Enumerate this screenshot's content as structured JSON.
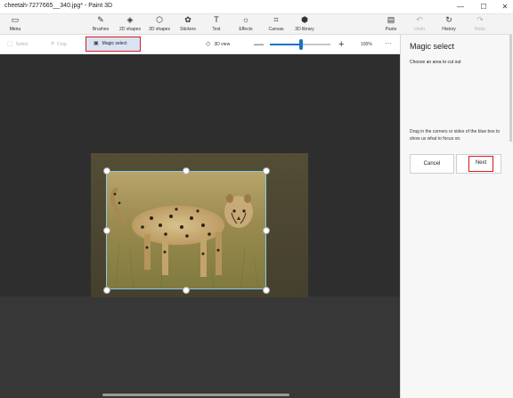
{
  "window": {
    "title": "cheetah-7277665__340.jpg* - Paint 3D",
    "minimize_glyph": "—",
    "maximize_glyph": "☐",
    "close_glyph": "✕"
  },
  "ribbon": {
    "menu": {
      "label": "Menu",
      "icon": "folder-icon",
      "glyph": "▭"
    },
    "tools": [
      {
        "label": "Brushes",
        "icon": "brush-icon",
        "glyph": "✎"
      },
      {
        "label": "2D shapes",
        "icon": "2d-shapes-icon",
        "glyph": "◈"
      },
      {
        "label": "3D shapes",
        "icon": "3d-shapes-icon",
        "glyph": "⬡"
      },
      {
        "label": "Stickers",
        "icon": "stickers-icon",
        "glyph": "✿"
      },
      {
        "label": "Text",
        "icon": "text-icon",
        "glyph": "T"
      },
      {
        "label": "Effects",
        "icon": "effects-icon",
        "glyph": "☼"
      },
      {
        "label": "Canvas",
        "icon": "canvas-icon",
        "glyph": "⌗"
      },
      {
        "label": "3D library",
        "icon": "3d-library-icon",
        "glyph": "⬢"
      }
    ],
    "paste": {
      "label": "Paste",
      "icon": "paste-icon",
      "glyph": "▤"
    },
    "undo": {
      "label": "Undo",
      "icon": "undo-icon",
      "glyph": "↶"
    },
    "history": {
      "label": "History",
      "icon": "history-icon",
      "glyph": "↻"
    },
    "redo": {
      "label": "Redo",
      "icon": "redo-icon",
      "glyph": "↷"
    }
  },
  "toolbar": {
    "select": {
      "label": "Select",
      "icon": "select-icon",
      "glyph": "⬚"
    },
    "crop": {
      "label": "Crop",
      "icon": "crop-icon",
      "glyph": "⌗"
    },
    "magic_select": {
      "label": "Magic select",
      "icon": "magic-select-icon",
      "glyph": "▣"
    },
    "view_3d": {
      "label": "3D view",
      "icon": "3d-view-icon",
      "glyph": "◇"
    },
    "zoom_minus": "—",
    "zoom_plus": "+",
    "zoom_value": "100%",
    "zoom_level": 0.52,
    "more": "···"
  },
  "panel": {
    "title": "Magic select",
    "subtitle": "Choose an area to cut out",
    "help": "Drag in the corners or sides of the blue box to show us what to focus on.",
    "cancel_label": "Cancel",
    "next_label": "Next"
  },
  "colors": {
    "accent": "#1a73c7",
    "highlight_box": "#d8191f",
    "selection_border": "#8ac8e8",
    "canvas_bg": "#2e2e2e"
  }
}
